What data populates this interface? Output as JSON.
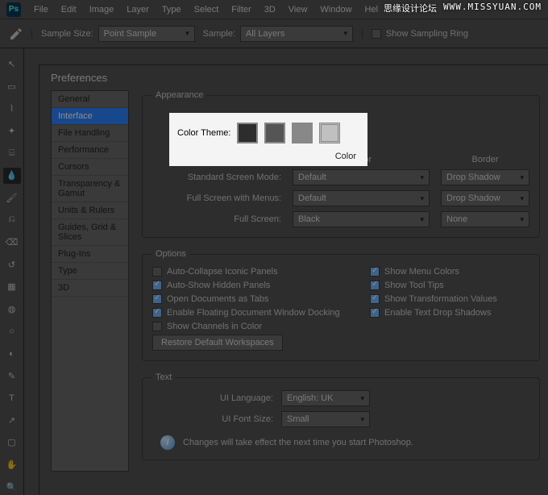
{
  "watermark": {
    "w1": "思缘设计论坛",
    "w2": "WWW.MISSYUAN.COM"
  },
  "menubar": {
    "logo": "Ps",
    "items": [
      "File",
      "Edit",
      "Image",
      "Layer",
      "Type",
      "Select",
      "Filter",
      "3D",
      "View",
      "Window",
      "Hel"
    ]
  },
  "optionsbar": {
    "sample_size_label": "Sample Size:",
    "sample_size_value": "Point Sample",
    "sample_label": "Sample:",
    "sample_value": "All Layers",
    "show_ring": "Show Sampling Ring"
  },
  "tools": [
    "move",
    "marquee",
    "lasso",
    "wand",
    "crop",
    "eyedropper",
    "brush",
    "clone",
    "eraser",
    "history",
    "gradient",
    "bucket",
    "blur",
    "dodge",
    "pen",
    "type",
    "path",
    "rect",
    "hand",
    "zoom"
  ],
  "tools_selected": "eyedropper",
  "prefs": {
    "title": "Preferences",
    "categories": [
      "General",
      "Interface",
      "File Handling",
      "Performance",
      "Cursors",
      "Transparency & Gamut",
      "Units & Rulers",
      "Guides, Grid & Slices",
      "Plug-Ins",
      "Type",
      "3D"
    ],
    "selected": "Interface",
    "appearance": {
      "legend": "Appearance",
      "color_theme_label": "Color Theme:",
      "color_label": "Color",
      "border_label": "Border",
      "rows": [
        {
          "label": "Standard Screen Mode:",
          "color": "Default",
          "border": "Drop Shadow"
        },
        {
          "label": "Full Screen with Menus:",
          "color": "Default",
          "border": "Drop Shadow"
        },
        {
          "label": "Full Screen:",
          "color": "Black",
          "border": "None"
        }
      ]
    },
    "options": {
      "legend": "Options",
      "left": [
        {
          "label": "Auto-Collapse Iconic Panels",
          "checked": false
        },
        {
          "label": "Auto-Show Hidden Panels",
          "checked": true
        },
        {
          "label": "Open Documents as Tabs",
          "checked": true
        },
        {
          "label": "Enable Floating Document Window Docking",
          "checked": true
        },
        {
          "label": "Show Channels in Color",
          "checked": false
        }
      ],
      "right": [
        {
          "label": "Show Menu Colors",
          "checked": true
        },
        {
          "label": "Show Tool Tips",
          "checked": true
        },
        {
          "label": "Show Transformation Values",
          "checked": true
        },
        {
          "label": "Enable Text Drop Shadows",
          "checked": true
        }
      ],
      "restore": "Restore Default Workspaces"
    },
    "text": {
      "legend": "Text",
      "ui_lang_label": "UI Language:",
      "ui_lang_value": "English: UK",
      "ui_font_label": "UI Font Size:",
      "ui_font_value": "Small",
      "note": "Changes will take effect the next time you start Photoshop."
    }
  }
}
